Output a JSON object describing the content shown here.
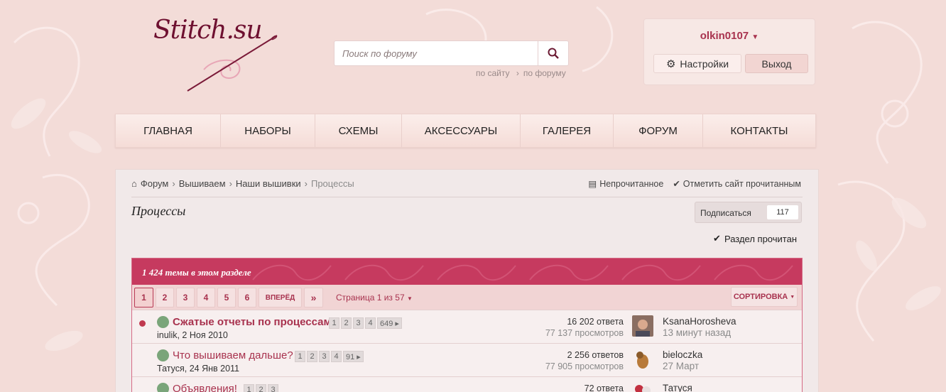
{
  "logo": {
    "text": "Stitch.su"
  },
  "search": {
    "placeholder": "Поиск по форуму",
    "scope_site": "по сайту",
    "scope_forum": "по форуму"
  },
  "user": {
    "name": "olkin0107",
    "settings_label": "Настройки",
    "logout_label": "Выход"
  },
  "nav": {
    "items": [
      {
        "label": "ГЛАВНАЯ"
      },
      {
        "label": "НАБОРЫ"
      },
      {
        "label": "СХЕМЫ"
      },
      {
        "label": "АКСЕССУАРЫ"
      },
      {
        "label": "ГАЛЕРЕЯ"
      },
      {
        "label": "ФОРУМ"
      },
      {
        "label": "КОНТАКТЫ"
      }
    ]
  },
  "breadcrumb": {
    "items": [
      "Форум",
      "Вышиваем",
      "Наши вышивки"
    ],
    "current": "Процессы"
  },
  "toplinks": {
    "unread": "Непрочитанное",
    "mark_site_read": "Отметить сайт прочитанным"
  },
  "page": {
    "title": "Процессы",
    "subscribe_label": "Подписаться",
    "subscribe_count": "117",
    "mark_section_read": "Раздел прочитан"
  },
  "threads_block": {
    "title": "1 424 темы в этом разделе",
    "pages": [
      "1",
      "2",
      "3",
      "4",
      "5",
      "6"
    ],
    "next_label": "ВПЕРЁД",
    "last_label": "»",
    "page_of": "Страница 1 из 57",
    "sort_label": "СОРТИРОВКА",
    "active_page": "1"
  },
  "threads": [
    {
      "title": "Сжатые отчеты по процессам",
      "unread": true,
      "pages": [
        "1",
        "2",
        "3",
        "4",
        "649"
      ],
      "author_date": "inulik, 2 Ноя 2010",
      "replies": "16 202 ответа",
      "views": "77 137 просмотров",
      "last_user": "KsanaHorosheva",
      "last_time": "13 минут назад"
    },
    {
      "title": "Что вышиваем дальше?",
      "unread": false,
      "pages": [
        "1",
        "2",
        "3",
        "4",
        "91"
      ],
      "author_date": "Татуся, 24 Янв 2011",
      "replies": "2 256 ответов",
      "views": "77 905 просмотров",
      "last_user": "bieloczka",
      "last_time": "27 Март"
    },
    {
      "title": "Объявления!",
      "unread": false,
      "pages": [
        "1",
        "2",
        "3"
      ],
      "author_date": "",
      "replies": "72 ответа",
      "views": "",
      "last_user": "Татуся",
      "last_time": ""
    }
  ]
}
